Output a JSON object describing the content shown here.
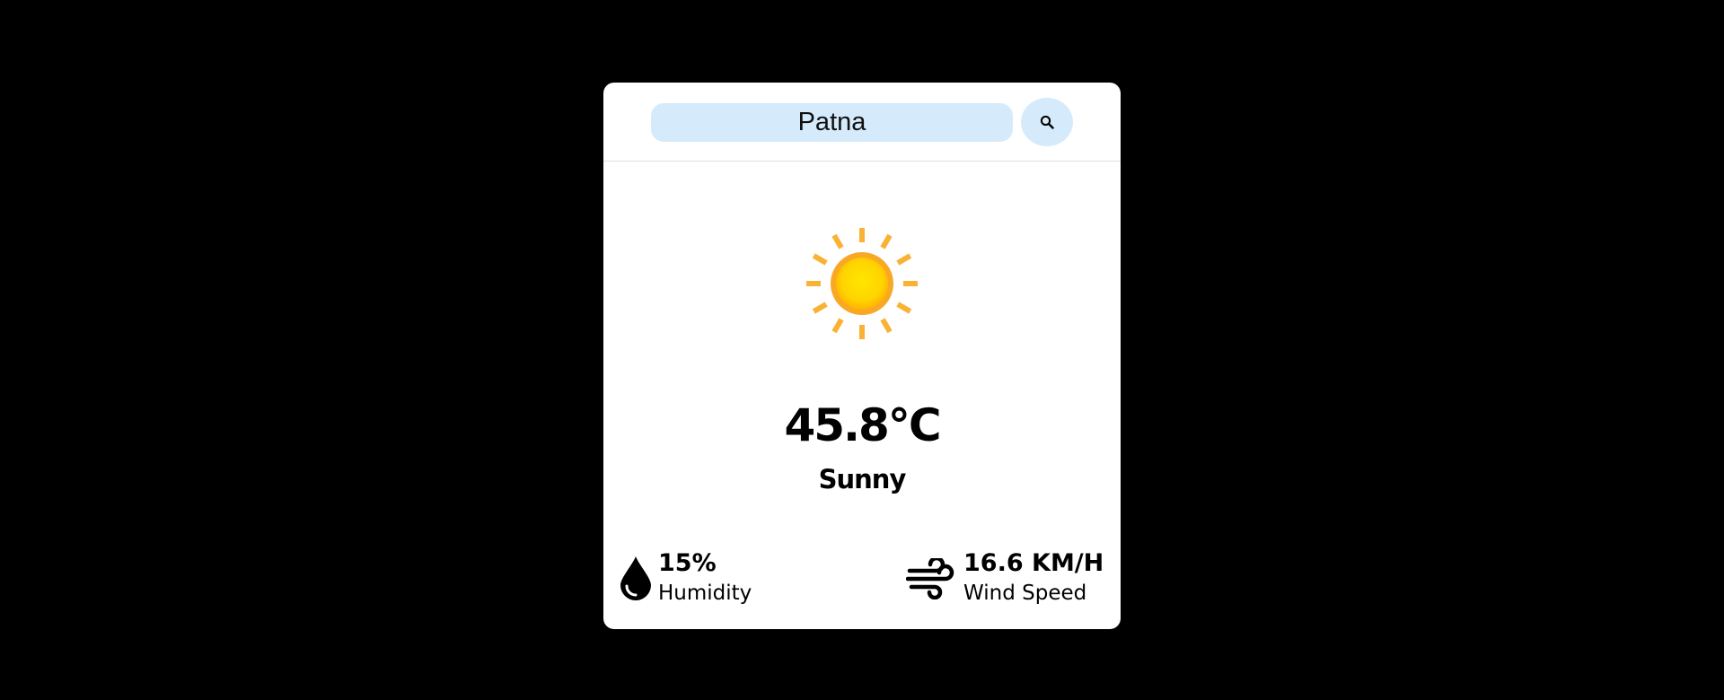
{
  "search": {
    "value": "Patna",
    "button_icon": "search-icon"
  },
  "weather": {
    "icon": "sun-icon",
    "temperature": "45.8°C",
    "condition": "Sunny"
  },
  "humidity": {
    "icon": "water-drop-icon",
    "value": "15%",
    "label": "Humidity"
  },
  "wind": {
    "icon": "wind-icon",
    "value": "16.6 KM/H",
    "label": "Wind Speed"
  },
  "colors": {
    "background": "#000000",
    "card": "#ffffff",
    "input_bg": "#d5ebfb",
    "sun_core": "#ffd700",
    "sun_rays": "#f9b233"
  }
}
